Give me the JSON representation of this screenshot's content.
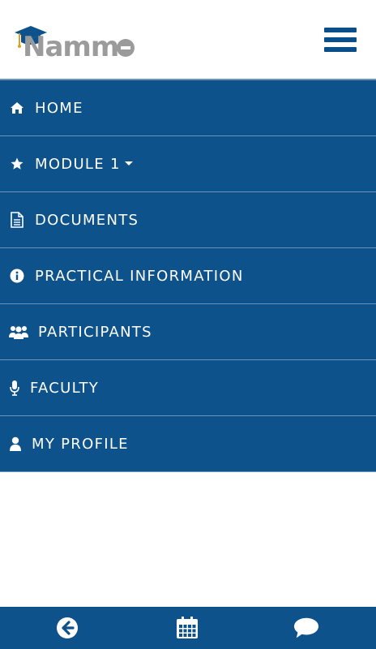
{
  "header": {
    "logo_text": "Namm",
    "menu_icon": "hamburger-icon"
  },
  "menu": {
    "items": [
      {
        "label": "HOME",
        "icon": "home-icon"
      },
      {
        "label": "MODULE 1",
        "icon": "star-icon",
        "has_dropdown": true
      },
      {
        "label": "DOCUMENTS",
        "icon": "document-icon"
      },
      {
        "label": "PRACTICAL INFORMATION",
        "icon": "info-icon"
      },
      {
        "label": "PARTICIPANTS",
        "icon": "users-icon"
      },
      {
        "label": "FACULTY",
        "icon": "microphone-icon"
      },
      {
        "label": "MY PROFILE",
        "icon": "user-icon"
      }
    ]
  },
  "bottom_bar": {
    "buttons": [
      {
        "icon": "back-arrow-icon"
      },
      {
        "icon": "calendar-icon"
      },
      {
        "icon": "chat-icon"
      }
    ]
  },
  "colors": {
    "primary": "#0e528b",
    "divider": "#6d93b8",
    "logo_gray": "#9b9b9b"
  }
}
